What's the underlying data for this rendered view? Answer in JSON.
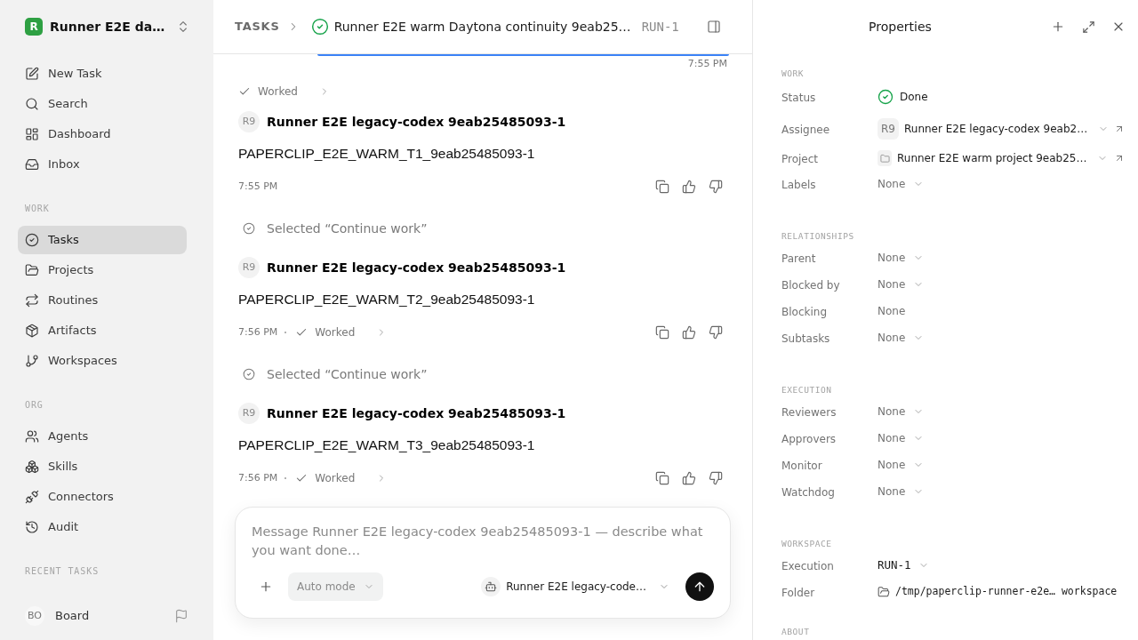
{
  "sidebar": {
    "workspace": {
      "logo": "R",
      "name": "Runner E2E da…"
    },
    "nav": [
      {
        "label": "New Task",
        "selected": false
      },
      {
        "label": "Search",
        "selected": false
      },
      {
        "label": "Dashboard",
        "selected": false
      },
      {
        "label": "Inbox",
        "selected": false
      }
    ],
    "sections": [
      {
        "title": "WORK",
        "items": [
          {
            "label": "Tasks",
            "selected": true
          },
          {
            "label": "Projects",
            "selected": false
          },
          {
            "label": "Routines",
            "selected": false
          },
          {
            "label": "Artifacts",
            "selected": false
          },
          {
            "label": "Workspaces",
            "selected": false
          }
        ]
      },
      {
        "title": "ORG",
        "items": [
          {
            "label": "Agents",
            "selected": false
          },
          {
            "label": "Skills",
            "selected": false
          },
          {
            "label": "Connectors",
            "selected": false
          },
          {
            "label": "Audit",
            "selected": false
          }
        ]
      },
      {
        "title": "RECENT TASKS"
      }
    ],
    "user": {
      "initials": "BO",
      "name": "Board"
    }
  },
  "task_header": {
    "breadcrumb": "TASKS",
    "done": true,
    "title": "Runner E2E warm Daytona continuity 9eab25…",
    "id": "RUN-1"
  },
  "thread": {
    "top_time": "7:55 PM",
    "items": [
      {
        "kind": "worked",
        "label": "Worked"
      },
      {
        "kind": "message",
        "avatar": "R9",
        "author": "Runner E2E legacy-codex 9eab25485093-1",
        "body": "PAPERCLIP_E2E_WARM_T1_9eab25485093-1",
        "time": "7:55 PM"
      },
      {
        "kind": "selection",
        "text": "Selected “Continue work”"
      },
      {
        "kind": "message",
        "avatar": "R9",
        "author": "Runner E2E legacy-codex 9eab25485093-1",
        "body": "PAPERCLIP_E2E_WARM_T2_9eab25485093-1",
        "time": "7:56 PM",
        "worked": "Worked"
      },
      {
        "kind": "selection",
        "text": "Selected “Continue work”"
      },
      {
        "kind": "message",
        "avatar": "R9",
        "author": "Runner E2E legacy-codex 9eab25485093-1",
        "body": "PAPERCLIP_E2E_WARM_T3_9eab25485093-1",
        "time": "7:56 PM",
        "worked": "Worked"
      }
    ]
  },
  "composer": {
    "placeholder": "Message Runner E2E legacy-codex 9eab25485093-1 — describe what you want done…",
    "mode": "Auto mode",
    "agent": "Runner E2E legacy-code…"
  },
  "properties": {
    "title": "Properties",
    "sections": [
      {
        "title": "WORK",
        "rows": [
          {
            "label": "Status",
            "kind": "status",
            "value": "Done"
          },
          {
            "label": "Assignee",
            "kind": "agent",
            "avatar": "R9",
            "value": "Runner E2E legacy-codex 9eab2…"
          },
          {
            "label": "Project",
            "kind": "project",
            "value": "Runner E2E warm project 9eab25…"
          },
          {
            "label": "Labels",
            "kind": "select",
            "value": "None"
          }
        ]
      },
      {
        "title": "RELATIONSHIPS",
        "rows": [
          {
            "label": "Parent",
            "kind": "select",
            "value": "None"
          },
          {
            "label": "Blocked by",
            "kind": "select",
            "value": "None"
          },
          {
            "label": "Blocking",
            "kind": "plain",
            "value": "None"
          },
          {
            "label": "Subtasks",
            "kind": "select",
            "value": "None"
          }
        ]
      },
      {
        "title": "EXECUTION",
        "rows": [
          {
            "label": "Reviewers",
            "kind": "select",
            "value": "None"
          },
          {
            "label": "Approvers",
            "kind": "select",
            "value": "None"
          },
          {
            "label": "Monitor",
            "kind": "select",
            "value": "None"
          },
          {
            "label": "Watchdog",
            "kind": "select",
            "value": "None"
          }
        ]
      },
      {
        "title": "WORKSPACE",
        "rows": [
          {
            "label": "Execution",
            "kind": "mono_select",
            "value": "RUN-1"
          },
          {
            "label": "Folder",
            "kind": "path",
            "value": "/tmp/paperclip-runner-e2e… workspace"
          }
        ]
      },
      {
        "title": "ABOUT"
      }
    ]
  }
}
